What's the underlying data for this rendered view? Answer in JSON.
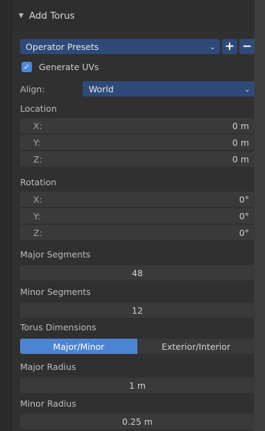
{
  "panel": {
    "title": "Add Torus",
    "collapse_glyph": "▼"
  },
  "presets": {
    "label": "Operator Presets",
    "add_glyph": "+",
    "remove_glyph": "−"
  },
  "generate_uvs": {
    "label": "Generate UVs",
    "checked": true,
    "check_glyph": "✓"
  },
  "align": {
    "label": "Align:",
    "value": "World"
  },
  "location": {
    "label": "Location",
    "fields": [
      {
        "axis": "X:",
        "value": "0 m"
      },
      {
        "axis": "Y:",
        "value": "0 m"
      },
      {
        "axis": "Z:",
        "value": "0 m"
      }
    ]
  },
  "rotation": {
    "label": "Rotation",
    "fields": [
      {
        "axis": "X:",
        "value": "0°"
      },
      {
        "axis": "Y:",
        "value": "0°"
      },
      {
        "axis": "Z:",
        "value": "0°"
      }
    ]
  },
  "major_segments": {
    "label": "Major Segments",
    "value": "48"
  },
  "minor_segments": {
    "label": "Minor Segments",
    "value": "12"
  },
  "torus_dimensions": {
    "label": "Torus Dimensions",
    "options": [
      "Major/Minor",
      "Exterior/Interior"
    ],
    "selected": "Major/Minor"
  },
  "major_radius": {
    "label": "Major Radius",
    "value": "1 m"
  },
  "minor_radius": {
    "label": "Minor Radius",
    "value": "0.25 m"
  },
  "colors": {
    "accent_blue": "#4d84d1",
    "select_blue": "#2f4a78",
    "panel_bg": "#303030",
    "field_bg": "#3a3a3a"
  },
  "icons": {
    "chevron": "chevron-down-icon",
    "check": "checkmark-icon",
    "collapse": "triangle-down-icon"
  }
}
